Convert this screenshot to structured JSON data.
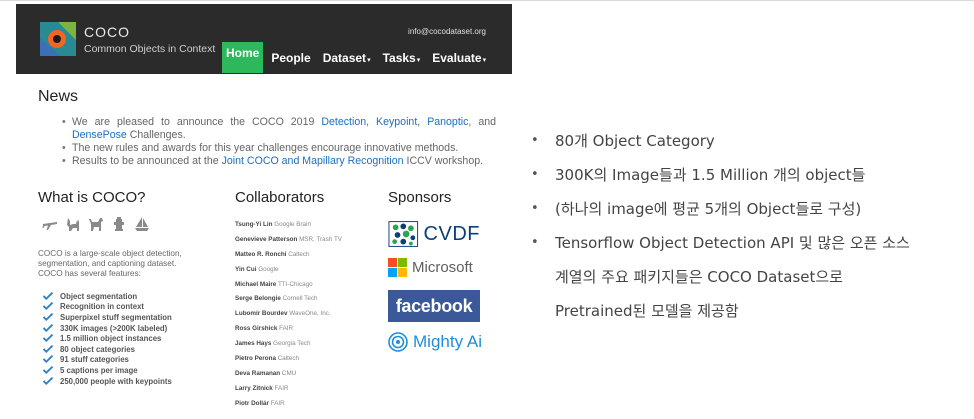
{
  "site": {
    "brand_title": "COCO",
    "brand_subtitle": "Common Objects in Context",
    "email": "info@cocodataset.org",
    "nav": [
      {
        "label": "Home",
        "active": true,
        "dropdown": false
      },
      {
        "label": "People",
        "active": false,
        "dropdown": false
      },
      {
        "label": "Dataset",
        "active": false,
        "dropdown": true
      },
      {
        "label": "Tasks",
        "active": false,
        "dropdown": true
      },
      {
        "label": "Evaluate",
        "active": false,
        "dropdown": true
      }
    ],
    "news_heading": "News",
    "news": {
      "item1_prefix": "We are pleased to announce the COCO 2019",
      "item1_link1": "Detection",
      "item1_link2": "Keypoint",
      "item1_link3": "Panoptic",
      "item1_and": "and",
      "item1_link4": "DensePose",
      "item1_suffix": "Challenges.",
      "item2": "The new rules and awards for this year challenges encourage innovative methods.",
      "item3_prefix": "Results to be announced at the",
      "item3_link": "Joint COCO and Mapillary Recognition",
      "item3_suffix": "ICCV workshop."
    },
    "what_heading": "What is COCO?",
    "what_description": "COCO is a large-scale object detection, segmentation, and captioning dataset. COCO has several features:",
    "animal_icons": [
      "airplane-icon",
      "cat-icon",
      "dog-icon",
      "fire-hydrant-icon",
      "sailboat-icon"
    ],
    "features": [
      "Object segmentation",
      "Recognition in context",
      "Superpixel stuff segmentation",
      "330K images (>200K labeled)",
      "1.5 million object instances",
      "80 object categories",
      "91 stuff categories",
      "5 captions per image",
      "250,000 people with keypoints"
    ],
    "collaborators_heading": "Collaborators",
    "collaborators": [
      {
        "name": "Tsung-Yi Lin",
        "aff": "Google Brain"
      },
      {
        "name": "Genevieve Patterson",
        "aff": "MSR, Trash TV"
      },
      {
        "name": "Matteo R. Ronchi",
        "aff": "Caltech"
      },
      {
        "name": "Yin Cui",
        "aff": "Google"
      },
      {
        "name": "Michael Maire",
        "aff": "TTI-Chicago"
      },
      {
        "name": "Serge Belongie",
        "aff": "Cornell Tech"
      },
      {
        "name": "Lubomir Bourdev",
        "aff": "WaveOne, Inc."
      },
      {
        "name": "Ross Girshick",
        "aff": "FAIR"
      },
      {
        "name": "James Hays",
        "aff": "Georgia Tech"
      },
      {
        "name": "Pietro Perona",
        "aff": "Caltech"
      },
      {
        "name": "Deva Ramanan",
        "aff": "CMU"
      },
      {
        "name": "Larry Zitnick",
        "aff": "FAIR"
      },
      {
        "name": "Piotr Dollár",
        "aff": "FAIR"
      }
    ],
    "sponsors_heading": "Sponsors",
    "sponsors": {
      "cvdf": "CVDF",
      "microsoft": "Microsoft",
      "facebook": "facebook",
      "mighty": "Mighty Ai"
    }
  },
  "slide_bullets": [
    "80개 Object Category",
    "300K의 Image들과 1.5 Million 개의 object들",
    "(하나의 image에 평균 5개의 Object들로 구성)",
    "Tensorflow Object Detection API 및 많은 오픈 소스"
  ],
  "slide_continuation": [
    "계열의 주요 패키지들은 COCO Dataset으로",
    "Pretrained된 모델을 제공함"
  ],
  "colors": {
    "navbar": "#2b2b2b",
    "active_nav": "#2eb85c",
    "link": "#1a6fc2",
    "check": "#2a7fc9",
    "facebook": "#3b5998"
  }
}
